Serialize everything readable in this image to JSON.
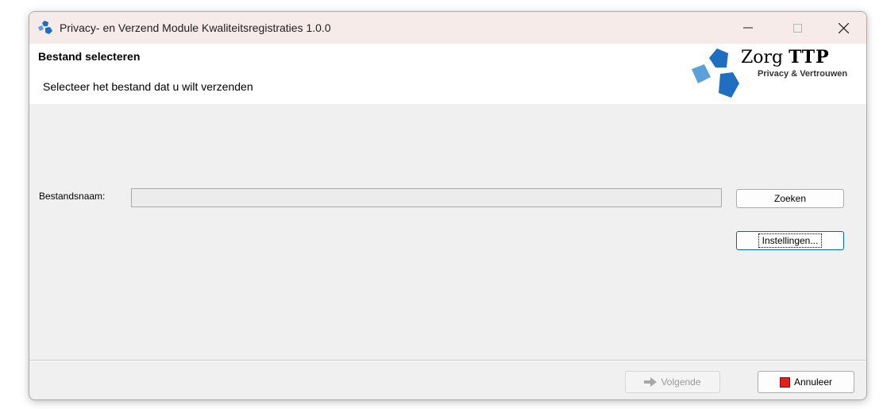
{
  "window": {
    "title": "Privacy- en Verzend Module Kwaliteitsregistraties 1.0.0"
  },
  "header": {
    "title": "Bestand selecteren",
    "subtitle": "Selecteer het bestand dat u wilt verzenden",
    "logo": {
      "name_regular": "Zorg",
      "name_bold": "TTP",
      "tagline": "Privacy & Vertrouwen"
    }
  },
  "form": {
    "filename_label": "Bestandsnaam:",
    "filename_value": "",
    "search_button": "Zoeken",
    "settings_button": "Instellingen..."
  },
  "footer": {
    "next_button": "Volgende",
    "cancel_button": "Annuleer"
  },
  "icons": {
    "app": "zorgttp-logo-icon",
    "next": "arrow-right-icon",
    "cancel": "stop-icon"
  },
  "colors": {
    "logo_blue_dark": "#1f6fc0",
    "logo_blue_light": "#5aa0dc",
    "cancel_red": "#e02020"
  }
}
